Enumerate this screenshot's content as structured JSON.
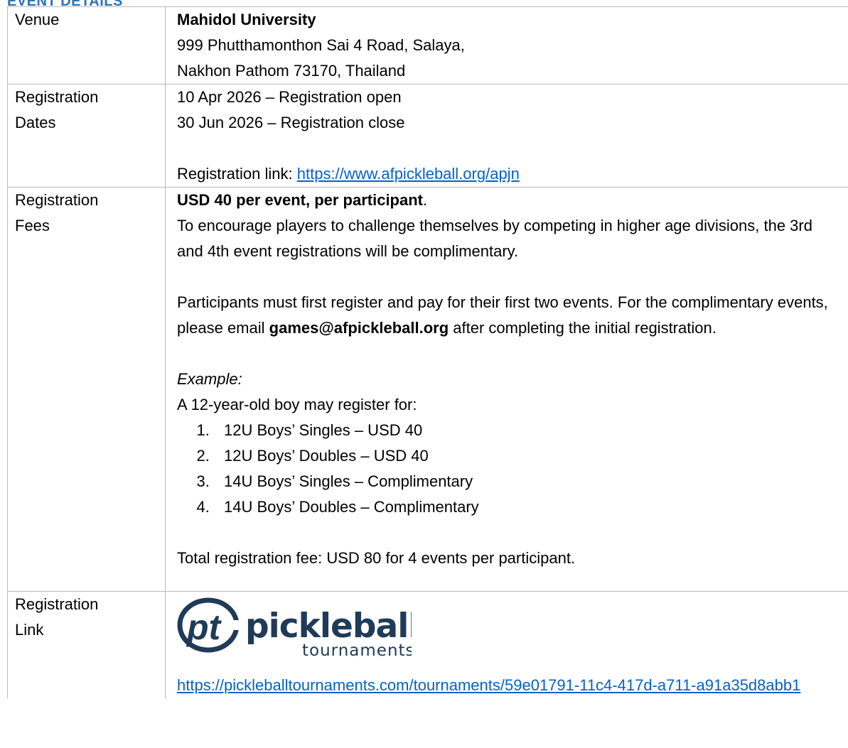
{
  "heading": "EVENT DETAILS",
  "rows": {
    "venue": {
      "label": "Venue",
      "name": "Mahidol University",
      "address_line1": "999 Phutthamonthon Sai 4 Road, Salaya,",
      "address_line2": "Nakhon Pathom 73170, Thailand"
    },
    "dates": {
      "label_line1": "Registration",
      "label_line2": "Dates",
      "open": "10 Apr 2026 – Registration open",
      "close": "30 Jun 2026 – Registration close",
      "link_prefix": "Registration link: ",
      "link_url": "https://www.afpickleball.org/apjn"
    },
    "fees": {
      "label_line1": "Registration",
      "label_line2": "Fees",
      "fee_bold": "USD 40 per event, per participant",
      "fee_period": ".",
      "encourage": "To encourage players to challenge themselves by competing in higher age divisions, the 3rd and 4th event registrations will be complimentary.",
      "must_first": "Participants must first register and pay for their first two events. For the complimentary events, please email ",
      "email": "games@afpickleball.org",
      "after": " after completing the initial registration.",
      "example_label": "Example:",
      "example_intro": "A 12-year-old boy may register for:",
      "events": [
        "12U Boys’ Singles – USD 40",
        "12U Boys’ Doubles – USD 40",
        "14U Boys’ Singles – Complimentary",
        "14U Boys’ Doubles – Complimentary"
      ],
      "total": "Total registration fee: USD 80 for 4 events per participant."
    },
    "link": {
      "label_line1": "Registration",
      "label_line2": "Link",
      "logo_letters": "pt",
      "logo_word": "pickleball",
      "logo_sub": "tournaments",
      "url": "https://pickleballtournaments.com/tournaments/59e01791-11c4-417d-a711-a91a35d8abb1"
    }
  },
  "colors": {
    "heading": "#2E74B5",
    "link": "#0563C1",
    "logo": "#1F3B57",
    "border": "#b9b9b9"
  }
}
